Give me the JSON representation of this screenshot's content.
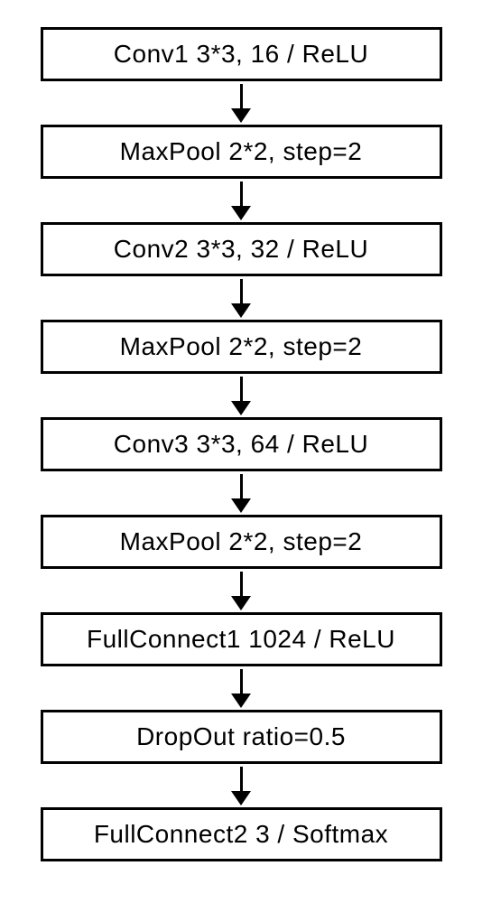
{
  "layers": [
    {
      "label": "Conv1 3*3, 16 / ReLU"
    },
    {
      "label": "MaxPool 2*2, step=2"
    },
    {
      "label": "Conv2 3*3, 32 / ReLU"
    },
    {
      "label": "MaxPool 2*2, step=2"
    },
    {
      "label": "Conv3 3*3, 64 / ReLU"
    },
    {
      "label": "MaxPool 2*2, step=2"
    },
    {
      "label": "FullConnect1 1024 / ReLU"
    },
    {
      "label": "DropOut ratio=0.5"
    },
    {
      "label": "FullConnect2 3 / Softmax"
    }
  ]
}
